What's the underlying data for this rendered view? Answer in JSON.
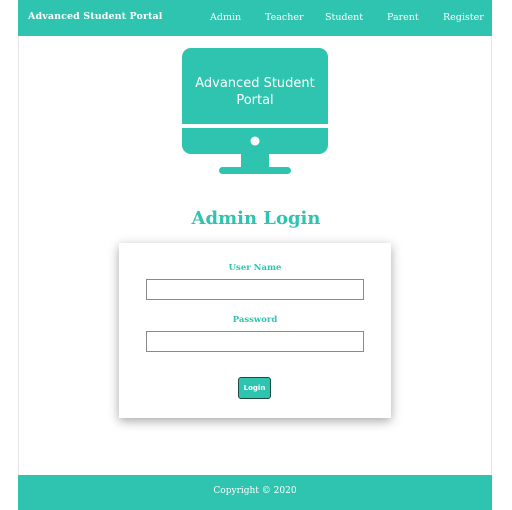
{
  "navbar": {
    "brand": "Advanced Student Portal",
    "links": [
      "Admin",
      "Teacher",
      "Student",
      "Parent",
      "Register"
    ]
  },
  "hero": {
    "monitor_text_line1": "Advanced Student",
    "monitor_text_line2": "Portal",
    "icon": "desktop-monitor-icon"
  },
  "login": {
    "title": "Admin Login",
    "username_label": "User Name",
    "username_value": "",
    "password_label": "Password",
    "password_value": "",
    "button_label": "Login"
  },
  "footer": {
    "copyright": "Copyright © 2020"
  },
  "colors": {
    "accent": "#2ec4b0",
    "text_on_accent": "#ffffff"
  }
}
